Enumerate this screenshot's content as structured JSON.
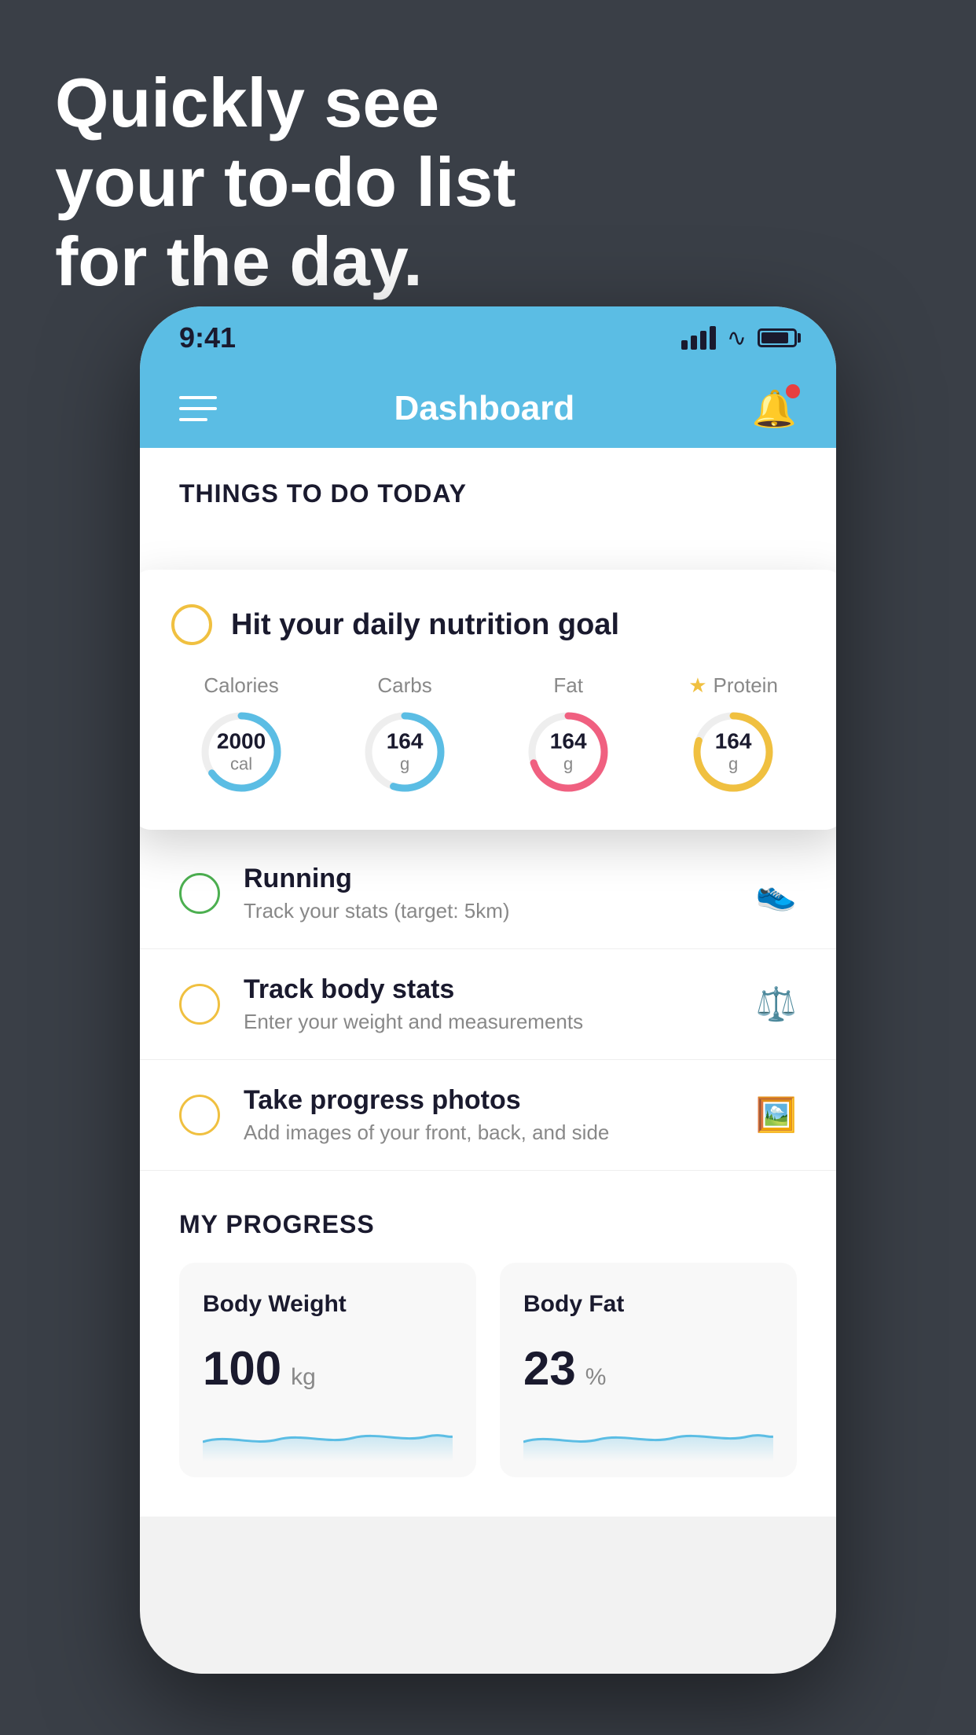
{
  "hero": {
    "line1": "Quickly see",
    "line2": "your to-do list",
    "line3": "for the day."
  },
  "status_bar": {
    "time": "9:41"
  },
  "nav": {
    "title": "Dashboard"
  },
  "things_today": {
    "header": "THINGS TO DO TODAY"
  },
  "featured_card": {
    "title": "Hit your daily nutrition goal",
    "nutrition": [
      {
        "label": "Calories",
        "value": "2000",
        "unit": "cal",
        "color": "#5bbde4",
        "percent": 65,
        "star": false
      },
      {
        "label": "Carbs",
        "value": "164",
        "unit": "g",
        "color": "#5bbde4",
        "percent": 55,
        "star": false
      },
      {
        "label": "Fat",
        "value": "164",
        "unit": "g",
        "color": "#f06080",
        "percent": 70,
        "star": false
      },
      {
        "label": "Protein",
        "value": "164",
        "unit": "g",
        "color": "#f0c040",
        "percent": 80,
        "star": true
      }
    ]
  },
  "todo_items": [
    {
      "title": "Running",
      "subtitle": "Track your stats (target: 5km)",
      "circle": "green",
      "icon": "👟"
    },
    {
      "title": "Track body stats",
      "subtitle": "Enter your weight and measurements",
      "circle": "yellow",
      "icon": "⚖️"
    },
    {
      "title": "Take progress photos",
      "subtitle": "Add images of your front, back, and side",
      "circle": "yellow",
      "icon": "🖼️"
    }
  ],
  "progress": {
    "header": "MY PROGRESS",
    "cards": [
      {
        "title": "Body Weight",
        "value": "100",
        "unit": "kg"
      },
      {
        "title": "Body Fat",
        "value": "23",
        "unit": "%"
      }
    ]
  }
}
